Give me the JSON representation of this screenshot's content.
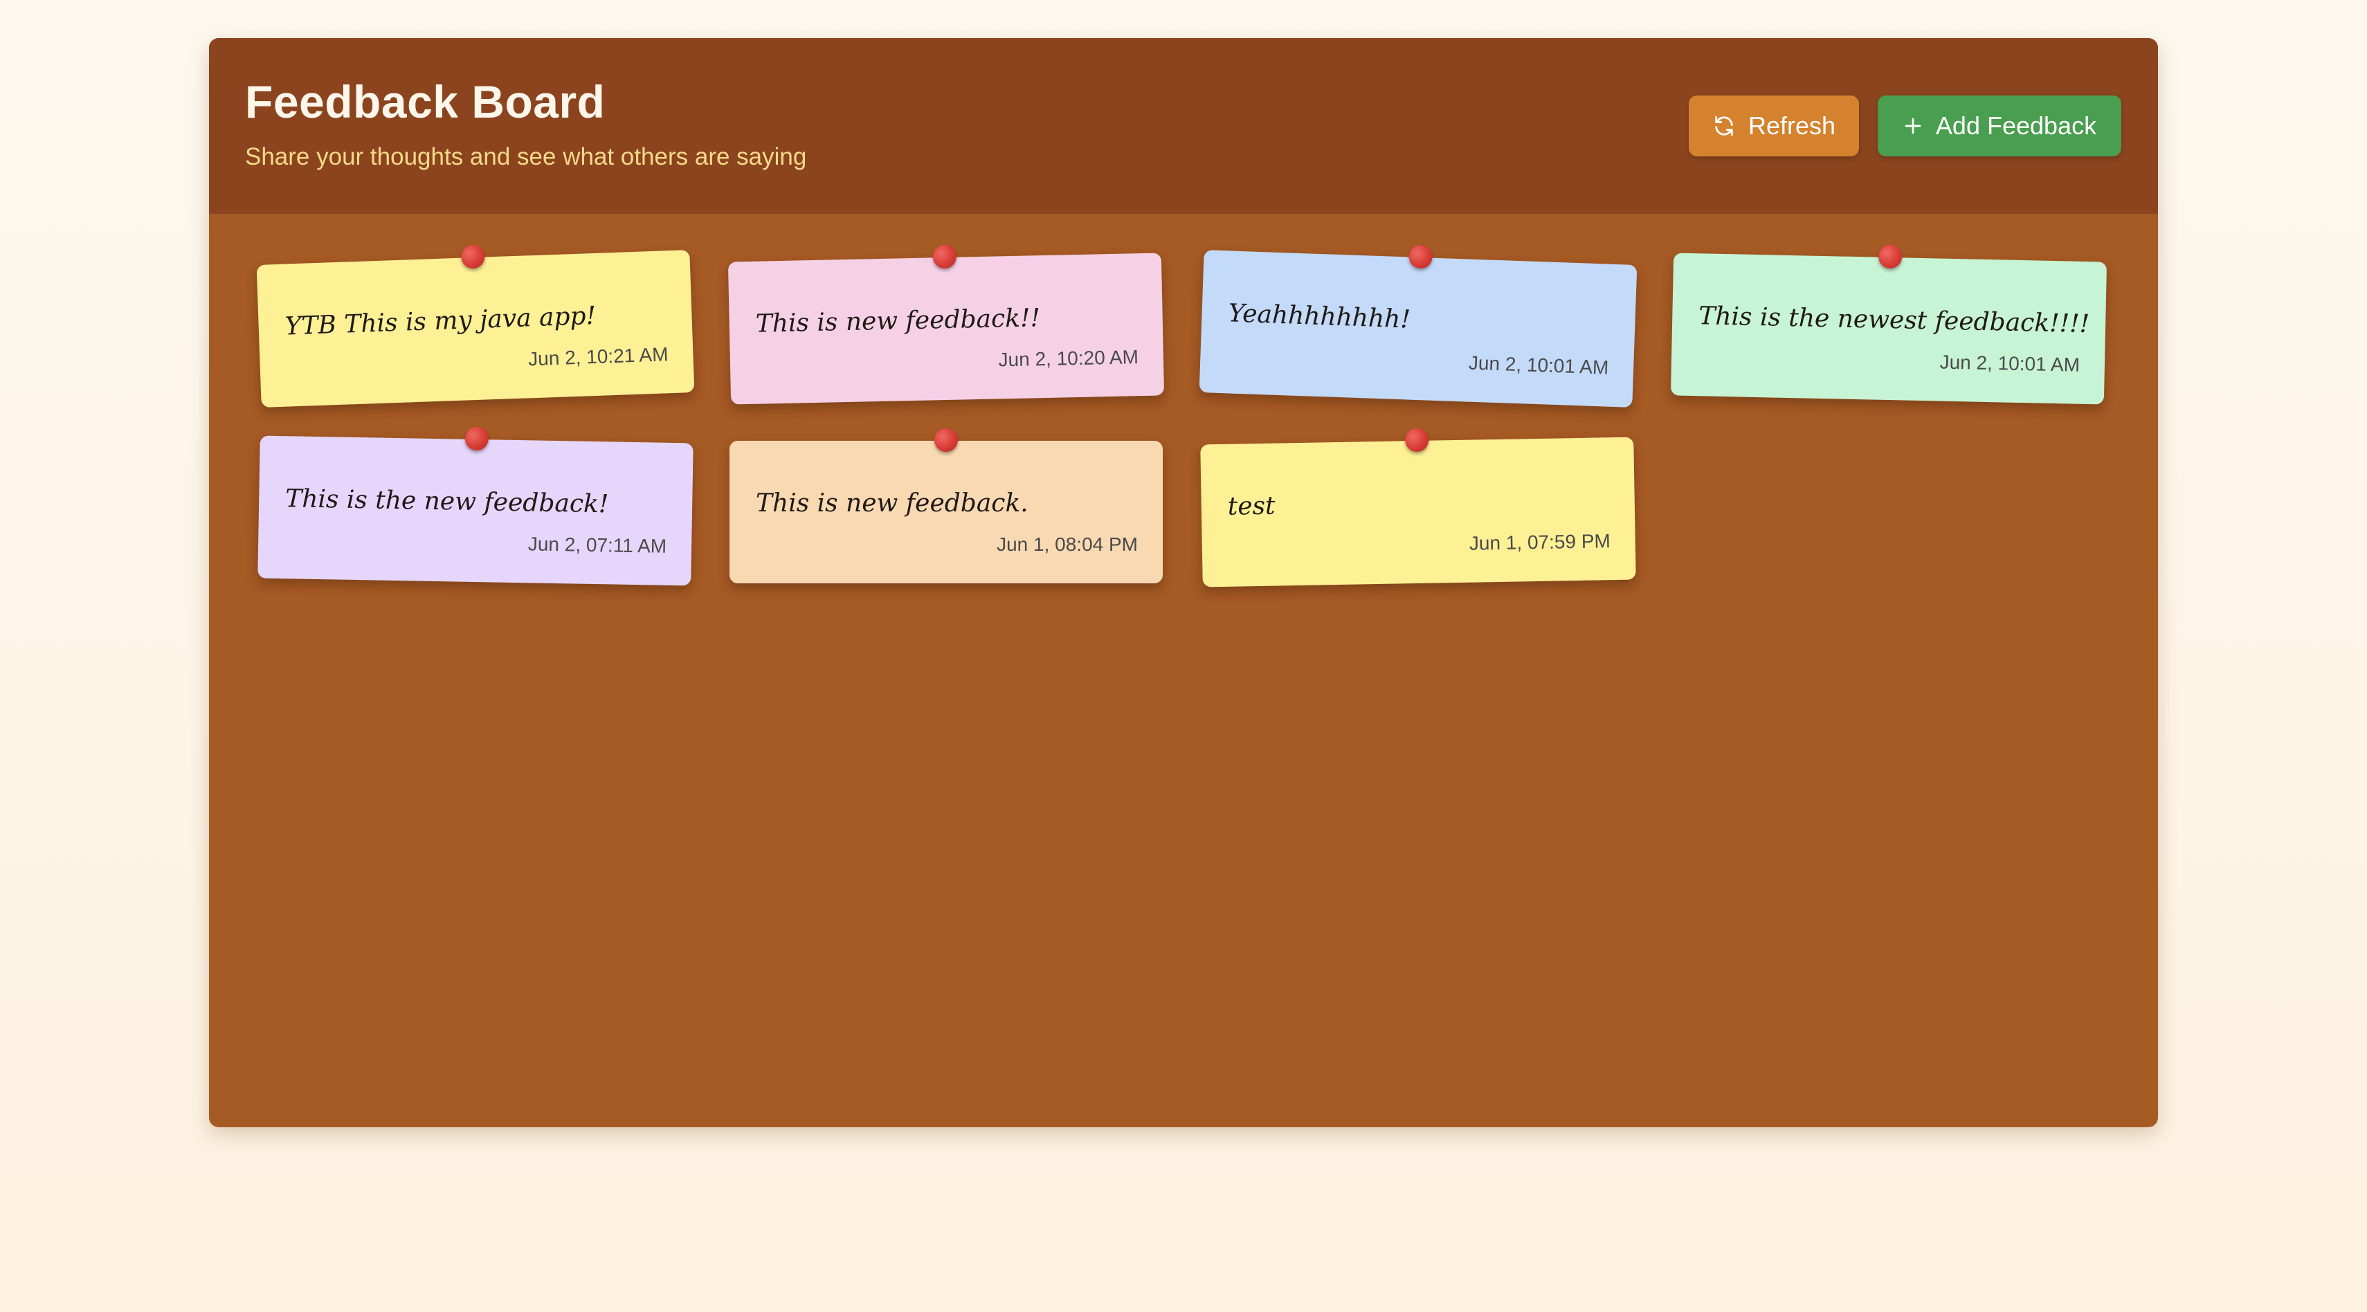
{
  "header": {
    "title": "Feedback Board",
    "subtitle": "Share your thoughts and see what others are saying",
    "refresh_label": "Refresh",
    "add_label": "Add Feedback"
  },
  "colors": {
    "board": "#a65a24",
    "header": "#8b441e",
    "refresh_button": "#d4822e",
    "add_button": "#4a9e4f",
    "pin": "#d83b35"
  },
  "icons": {
    "refresh": "refresh-icon",
    "add": "plus-icon",
    "pin": "pin-icon"
  },
  "notes": [
    {
      "text": "YTB This is my java app!",
      "date": "Jun 2, 10:21 AM",
      "color": "#fdf095"
    },
    {
      "text": "This is new feedback!!",
      "date": "Jun 2, 10:20 AM",
      "color": "#f6d1e6"
    },
    {
      "text": "Yeahhhhhhhh!",
      "date": "Jun 2, 10:01 AM",
      "color": "#c4daf9"
    },
    {
      "text": "This is the newest feedback!!!!",
      "date": "Jun 2, 10:01 AM",
      "color": "#c7f4d4"
    },
    {
      "text": "This is the new feedback!",
      "date": "Jun 2, 07:11 AM",
      "color": "#e6d6fc"
    },
    {
      "text": "This is new feedback.",
      "date": "Jun 1, 08:04 PM",
      "color": "#f8d9b2"
    },
    {
      "text": "test",
      "date": "Jun 1, 07:59 PM",
      "color": "#fdf095"
    }
  ]
}
